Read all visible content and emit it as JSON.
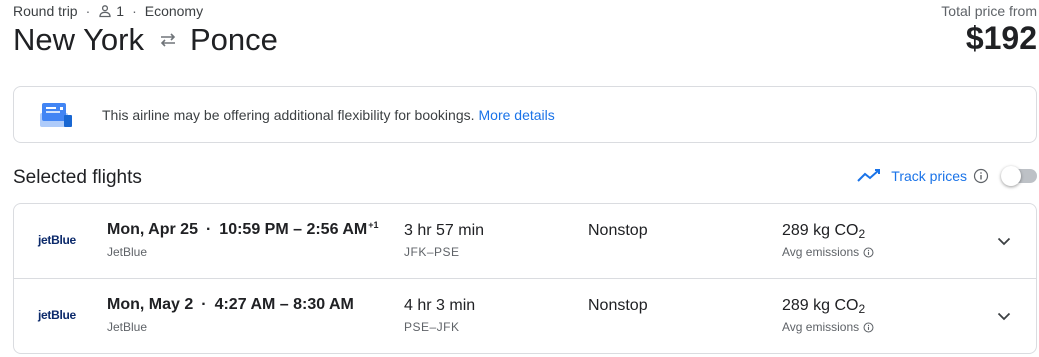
{
  "header": {
    "trip_type": "Round trip",
    "passengers": "1",
    "cabin": "Economy",
    "origin": "New York",
    "destination": "Ponce",
    "price_label": "Total price from",
    "price": "$192"
  },
  "banner": {
    "text": "This airline may be offering additional flexibility for bookings.",
    "link": "More details"
  },
  "section": {
    "title": "Selected flights",
    "track_label": "Track prices",
    "track_enabled": false
  },
  "flights": [
    {
      "logo": "jetBlue",
      "date": "Mon, Apr 25",
      "times": "10:59 PM – 2:56 AM",
      "day_offset": "+1",
      "airline": "JetBlue",
      "duration": "3 hr 57 min",
      "airports": "JFK–PSE",
      "stops": "Nonstop",
      "emissions_value": "289 kg CO",
      "emissions_sub": "2",
      "emissions_label": "Avg emissions"
    },
    {
      "logo": "jetBlue",
      "date": "Mon, May 2",
      "times": "4:27 AM – 8:30 AM",
      "day_offset": "",
      "airline": "JetBlue",
      "duration": "4 hr 3 min",
      "airports": "PSE–JFK",
      "stops": "Nonstop",
      "emissions_value": "289 kg CO",
      "emissions_sub": "2",
      "emissions_label": "Avg emissions"
    }
  ],
  "colors": {
    "link": "#1a73e8",
    "jetblue": "#0c2a6b",
    "border": "#dadce0"
  },
  "icons": [
    "person-icon",
    "swap-icon",
    "flexible-booking-icon",
    "trend-icon",
    "info-icon",
    "chevron-down-icon"
  ]
}
